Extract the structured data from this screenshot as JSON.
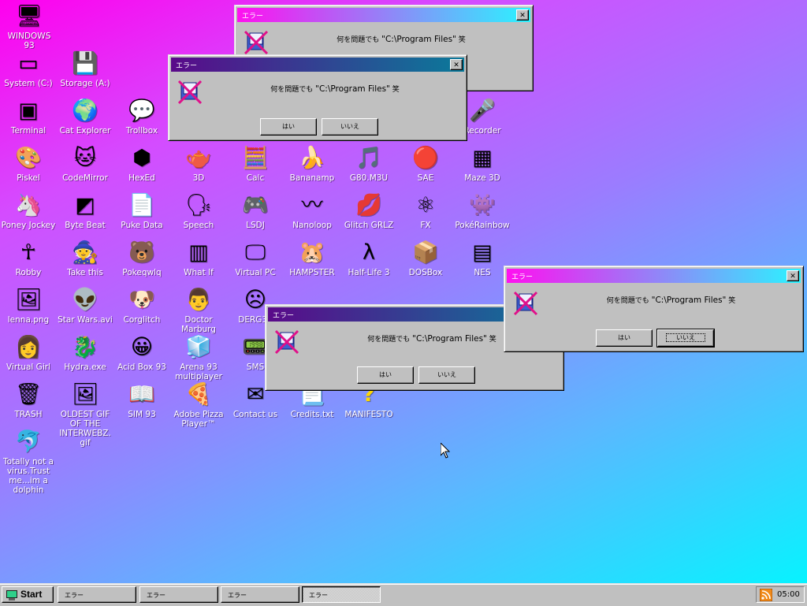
{
  "desktop": {
    "icons": [
      {
        "label": "WINDOWS 93",
        "icon": "computer-icon",
        "glyph": "🖥"
      },
      {
        "label": "System (C:)",
        "icon": "hard-drive-icon",
        "glyph": "▭"
      },
      {
        "label": "Storage (A:)",
        "icon": "floppy-drive-icon",
        "glyph": "💾"
      },
      {
        "label": "Terminal",
        "icon": "terminal-icon",
        "glyph": "▣"
      },
      {
        "label": "Cat Explorer",
        "icon": "cat-globe-icon",
        "glyph": "🌍"
      },
      {
        "label": "Trollbox",
        "icon": "chat-bubble-icon",
        "glyph": "💬"
      },
      {
        "label": "Recorder",
        "icon": "microphone-icon",
        "glyph": "🎤"
      },
      {
        "label": "Piskel",
        "icon": "palette-icon",
        "glyph": "🎨"
      },
      {
        "label": "CodeMirror",
        "icon": "codemirror-icon",
        "glyph": "🐱"
      },
      {
        "label": "HexEd",
        "icon": "cube-icon",
        "glyph": "⬢"
      },
      {
        "label": "3D",
        "icon": "teapot-icon",
        "glyph": "🫖"
      },
      {
        "label": "Calc",
        "icon": "calculator-icon",
        "glyph": "🧮"
      },
      {
        "label": "Bananamp",
        "icon": "banana-icon",
        "glyph": "🍌"
      },
      {
        "label": "G80.M3U",
        "icon": "playlist-icon",
        "glyph": "🎵"
      },
      {
        "label": "SAE",
        "icon": "checker-ball-icon",
        "glyph": "🔴"
      },
      {
        "label": "Maze 3D",
        "icon": "maze-icon",
        "glyph": "▦"
      },
      {
        "label": "Poney Jockey",
        "icon": "pony-icon",
        "glyph": "🦄"
      },
      {
        "label": "Byte Beat",
        "icon": "bytebeat-icon",
        "glyph": "◩"
      },
      {
        "label": "Puke Data",
        "icon": "pd-icon",
        "glyph": "📄"
      },
      {
        "label": "Speech",
        "icon": "speech-face-icon",
        "glyph": "🗣"
      },
      {
        "label": "LSDJ",
        "icon": "gameboy-icon",
        "glyph": "🎮"
      },
      {
        "label": "Nanoloop",
        "icon": "wave-icon",
        "glyph": "〰"
      },
      {
        "label": "Glitch GRLZ",
        "icon": "lips-icon",
        "glyph": "💋"
      },
      {
        "label": "FX",
        "icon": "atom-icon",
        "glyph": "⚛"
      },
      {
        "label": "PokéRainbow",
        "icon": "pokerainbow-icon",
        "glyph": "👾"
      },
      {
        "label": "Robby",
        "icon": "stick-figure-icon",
        "glyph": "☥"
      },
      {
        "label": "Take this",
        "icon": "take-this-icon",
        "glyph": "🧙"
      },
      {
        "label": "Pokeqwlq",
        "icon": "pokemon-icon",
        "glyph": "🐻"
      },
      {
        "label": "What If",
        "icon": "what-if-icon",
        "glyph": "▥"
      },
      {
        "label": "Virtual PC",
        "icon": "virtual-pc-icon",
        "glyph": "🖵"
      },
      {
        "label": "HAMPSTER",
        "icon": "hamster-icon",
        "glyph": "🐹"
      },
      {
        "label": "Half-Life 3",
        "icon": "half-life-icon",
        "glyph": "λ"
      },
      {
        "label": "DOSBox",
        "icon": "dosbox-icon",
        "glyph": "📦"
      },
      {
        "label": "NES",
        "icon": "nes-icon",
        "glyph": "▤"
      },
      {
        "label": "lenna.png",
        "icon": "image-file-icon",
        "glyph": "🖼"
      },
      {
        "label": "Star Wars.avi",
        "icon": "yoda-icon",
        "glyph": "👽"
      },
      {
        "label": "Corglitch",
        "icon": "corgi-icon",
        "glyph": "🐶"
      },
      {
        "label": "Doctor Marburg",
        "icon": "doctor-icon",
        "glyph": "👨"
      },
      {
        "label": "DERG32",
        "icon": "derg-icon",
        "glyph": "☹"
      },
      {
        "label": "Virtual Girl",
        "icon": "virtual-girl-icon",
        "glyph": "👩"
      },
      {
        "label": "Hydra.exe",
        "icon": "hydra-icon",
        "glyph": "🐉"
      },
      {
        "label": "Acid Box 93",
        "icon": "smiley-icon",
        "glyph": "😀"
      },
      {
        "label": "Arena 93 multiplayer",
        "icon": "arena-cube-icon",
        "glyph": "🧊"
      },
      {
        "label": "SMS",
        "icon": "sms-icon",
        "glyph": "📟"
      },
      {
        "label": "TRASH",
        "icon": "trash-icon",
        "glyph": "🗑"
      },
      {
        "label": "OLDEST GIF OF THE INTERWEBZ.gif",
        "icon": "gif-file-icon",
        "glyph": "🖼"
      },
      {
        "label": "SIM 93",
        "icon": "book-icon",
        "glyph": "📖"
      },
      {
        "label": "Adobe Pizza Player™",
        "icon": "pizza-icon",
        "glyph": "🍕"
      },
      {
        "label": "Contact us",
        "icon": "contact-icon",
        "glyph": "✉"
      },
      {
        "label": "Credits.txt",
        "icon": "text-file-icon",
        "glyph": "📃"
      },
      {
        "label": "MANIFESTO",
        "icon": "question-icon",
        "glyph": "?"
      },
      {
        "label": "Totally not a virus.Trust me...im a dolphin",
        "icon": "dolphin-icon",
        "glyph": "🐬"
      }
    ]
  },
  "dialogs": [
    {
      "title": "エラー",
      "message_prefix": "何を問題でも",
      "path": "\"C:\\Program Files\"",
      "message_suffix": "笑",
      "yes_label": "はい",
      "no_label": "いいえ"
    },
    {
      "title": "エラー",
      "message_prefix": "何を問題でも",
      "path": "\"C:\\Program Files\"",
      "message_suffix": "笑",
      "yes_label": "はい",
      "no_label": "いいえ"
    },
    {
      "title": "エラー",
      "message_prefix": "何を問題でも",
      "path": "\"C:\\Program Files\"",
      "message_suffix": "笑",
      "yes_label": "はい",
      "no_label": "いいえ"
    },
    {
      "title": "エラー",
      "message_prefix": "何を問題でも",
      "path": "\"C:\\Program Files\"",
      "message_suffix": "笑",
      "yes_label": "はい",
      "no_label": "いいえ"
    }
  ],
  "taskbar": {
    "start_label": "Start",
    "buttons": [
      {
        "label": "エラー"
      },
      {
        "label": "エラー"
      },
      {
        "label": "エラー"
      },
      {
        "label": "エラー"
      }
    ],
    "clock": "05:00"
  },
  "colors": {
    "gradient_top_left": "#ff00ee",
    "gradient_bottom_right": "#00f8ff",
    "titlebar_active_start": "#5a0a8a",
    "titlebar_active_end": "#0a7a9a",
    "titlebar_inactive_start": "#ff10f0",
    "titlebar_inactive_end": "#2af4ff",
    "chrome": "#c0c0c0"
  }
}
